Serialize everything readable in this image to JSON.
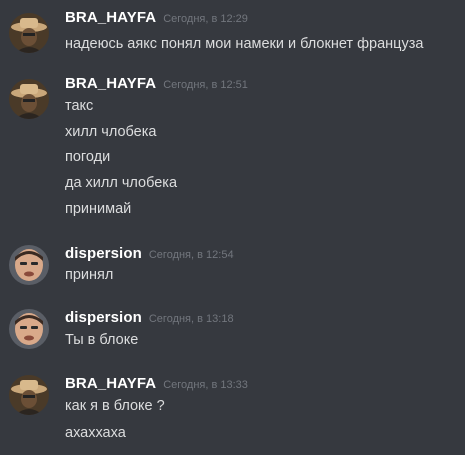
{
  "colors": {
    "background": "#36393f",
    "username": "#ffffff",
    "timestamp": "#72767d",
    "message_text": "#dcddde"
  },
  "messages": [
    {
      "author": "BRA_HAYFA",
      "avatar_icon": "cowboy-avatar-icon",
      "time": "Сегодня, в 12:29",
      "lines": [
        "надеюсь аякс понял мои намеки и блокнет француза"
      ]
    },
    {
      "author": "BRA_HAYFA",
      "avatar_icon": "cowboy-avatar-icon",
      "time": "Сегодня, в 12:51",
      "lines": [
        "такс",
        "хилл члобека",
        "погоди",
        "да хилл члобека",
        "принимай"
      ]
    },
    {
      "author": "dispersion",
      "avatar_icon": "bald-man-avatar-icon",
      "time": "Сегодня, в 12:54",
      "lines": [
        "принял"
      ]
    },
    {
      "author": "dispersion",
      "avatar_icon": "bald-man-avatar-icon",
      "time": "Сегодня, в 13:18",
      "lines": [
        "Ты в блоке"
      ]
    },
    {
      "author": "BRA_HAYFA",
      "avatar_icon": "cowboy-avatar-icon",
      "time": "Сегодня, в 13:33",
      "lines": [
        "как я в блоке ?",
        "ахаххаха"
      ]
    }
  ]
}
